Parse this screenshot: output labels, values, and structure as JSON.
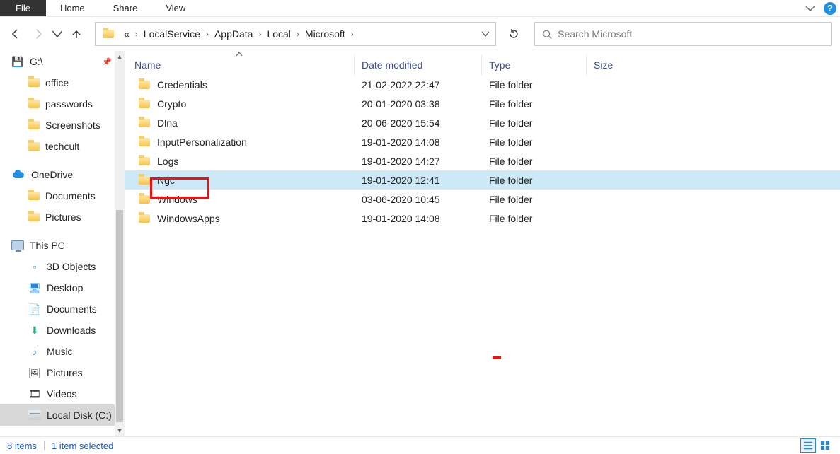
{
  "ribbon": {
    "file": "File",
    "home": "Home",
    "share": "Share",
    "view": "View"
  },
  "breadcrumb": {
    "overflow": "«",
    "items": [
      "LocalService",
      "AppData",
      "Local",
      "Microsoft"
    ]
  },
  "search": {
    "placeholder": "Search Microsoft"
  },
  "tree": {
    "g_drive": "G:\\",
    "quick": [
      "office",
      "passwords",
      "Screenshots",
      "techcult"
    ],
    "onedrive": "OneDrive",
    "onedrive_children": [
      "Documents",
      "Pictures"
    ],
    "thispc": "This PC",
    "thispc_children": [
      "3D Objects",
      "Desktop",
      "Documents",
      "Downloads",
      "Music",
      "Pictures",
      "Videos",
      "Local Disk (C:)"
    ]
  },
  "columns": {
    "name": "Name",
    "date": "Date modified",
    "type": "Type",
    "size": "Size"
  },
  "rows": [
    {
      "name": "Credentials",
      "date": "21-02-2022 22:47",
      "type": "File folder"
    },
    {
      "name": "Crypto",
      "date": "20-01-2020 03:38",
      "type": "File folder"
    },
    {
      "name": "Dlna",
      "date": "20-06-2020 15:54",
      "type": "File folder"
    },
    {
      "name": "InputPersonalization",
      "date": "19-01-2020 14:08",
      "type": "File folder"
    },
    {
      "name": "Logs",
      "date": "19-01-2020 14:27",
      "type": "File folder"
    },
    {
      "name": "Ngc",
      "date": "19-01-2020 12:41",
      "type": "File folder",
      "selected": true,
      "highlighted": true
    },
    {
      "name": "Windows",
      "date": "03-06-2020 10:45",
      "type": "File folder"
    },
    {
      "name": "WindowsApps",
      "date": "19-01-2020 14:08",
      "type": "File folder"
    }
  ],
  "status": {
    "items": "8 items",
    "selected": "1 item selected"
  }
}
